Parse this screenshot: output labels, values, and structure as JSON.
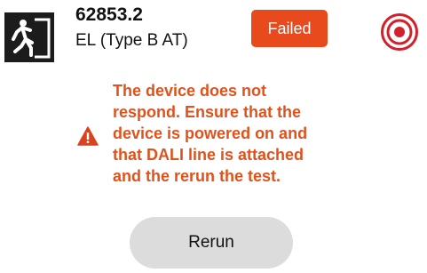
{
  "device": {
    "id": "62853.2",
    "type": "EL (Type B AT)",
    "icon": "emergency-exit-icon"
  },
  "status": {
    "label": "Failed",
    "color": "#e8491d"
  },
  "identify": {
    "icon": "target-icon",
    "color": "#d4202a"
  },
  "error": {
    "icon": "warning-icon",
    "message": "The device does not\nrespond. Ensure that the\ndevice is powered on and\nthat DALI line is attached\nand the rerun the test.",
    "color": "#e0521c"
  },
  "actions": {
    "rerun_label": "Rerun"
  }
}
